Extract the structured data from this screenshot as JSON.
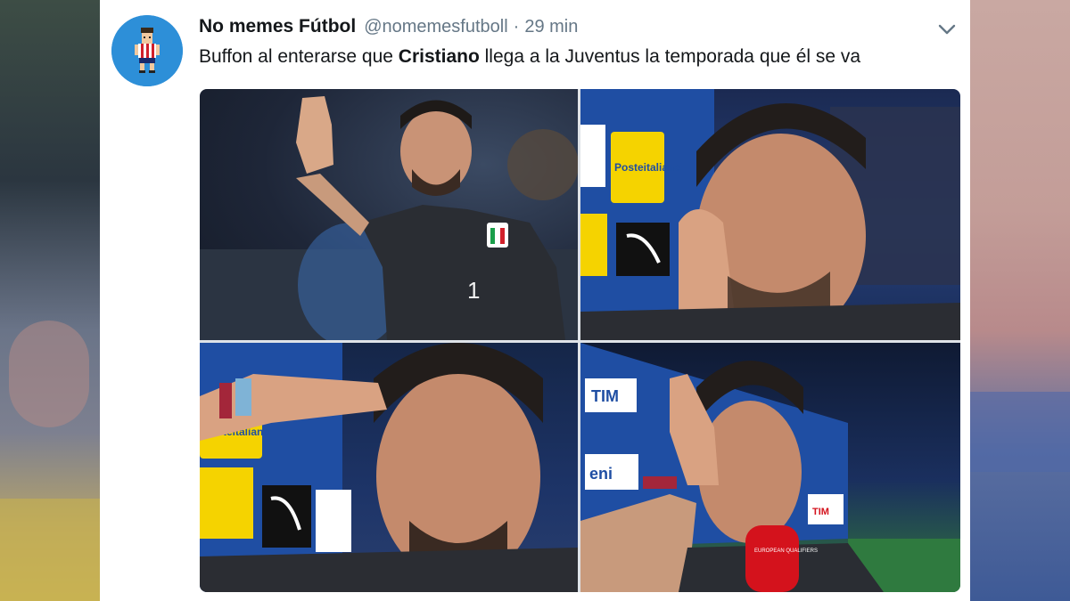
{
  "tweet": {
    "display_name": "No memes Fútbol",
    "handle": "@nomemesfutboll",
    "separator": "·",
    "time": "29 min",
    "text_before": "Buffon al enterarse que ",
    "text_bold": "Cristiano",
    "text_after": " llega a la Juventus la temporada que él se va"
  },
  "media_signage": {
    "sponsor_1": "Posteitaliane",
    "sponsor_2": "TIM",
    "sponsor_3": "eni",
    "jersey_number": "1",
    "mic_text": "EUROPEAN QUALIFIERS"
  },
  "colors": {
    "avatar_bg": "#2d8fd8",
    "handle_gray": "#657786",
    "sponsor_yellow": "#f5d300",
    "ad_blue": "#1f4ea3",
    "mic_red": "#d4121c"
  },
  "icons": {
    "avatar": "user-avatar-icon",
    "menu": "chevron-down-icon"
  }
}
